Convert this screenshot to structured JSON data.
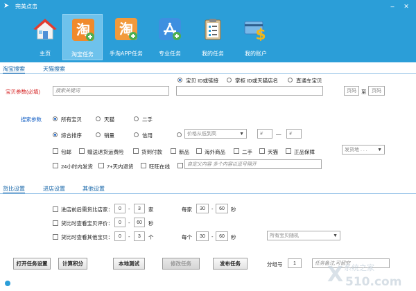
{
  "window": {
    "title": "完美点击"
  },
  "nav": [
    {
      "label": "主页",
      "icon": "home-icon",
      "active": false
    },
    {
      "label": "淘宝任务",
      "icon": "taobao-icon",
      "active": true
    },
    {
      "label": "手淘APP任务",
      "icon": "taobao-app-icon",
      "active": false
    },
    {
      "label": "专业任务",
      "icon": "appstore-icon",
      "active": false
    },
    {
      "label": "我的任务",
      "icon": "clipboard-icon",
      "active": false
    },
    {
      "label": "我的账户",
      "icon": "card-dollar-icon",
      "active": false
    }
  ],
  "search_tabs": [
    "淘宝搜索",
    "天猫搜索"
  ],
  "product_param": {
    "label": "宝贝参数(必填)",
    "keyword_placeholder": "搜索关键词",
    "radios": [
      "宝贝 ID或链接",
      "掌柜 ID或天猫店名",
      "直通车宝贝"
    ],
    "page_from_placeholder": "页码",
    "page_to_label": "至",
    "page_to_placeholder": "页码"
  },
  "search_params": {
    "label": "搜索参数",
    "type_radios": [
      "所有宝贝",
      "天猫",
      "二手"
    ],
    "sort_radios": [
      "综合排序",
      "销量",
      "信用"
    ],
    "price_sort_placeholder": "价格从低到高",
    "price_min_placeholder": "¥",
    "price_dash": "—",
    "price_max_placeholder": "¥",
    "checkboxes_row1": [
      "包邮",
      "赠送退货运费险",
      "货到付款",
      "新品",
      "海外商品",
      "二手",
      "天猫",
      "正品保障"
    ],
    "ship_from_placeholder": "发货地 . . .",
    "checkboxes_row2": [
      "24小时内发货",
      "7+天内退货",
      "旺旺在线"
    ],
    "custom_placeholder": "自定义内容    多个内容以逗号隔开"
  },
  "settings_tabs": [
    "货比设置",
    "进店设置",
    "其他设置"
  ],
  "compare": {
    "row1": {
      "label": "进店前后需货比店家：",
      "from": "0",
      "to": "3",
      "unit": "家",
      "each_label": "每家",
      "sec_from": "30",
      "sec_to": "60",
      "sec_unit": "秒"
    },
    "row2": {
      "label": "货比时查看宝贝评价：",
      "from": "0",
      "to": "60",
      "unit": "秒"
    },
    "row3": {
      "label": "货比时查看其他宝贝：",
      "from": "0",
      "to": "3",
      "unit": "个",
      "each_label": "每个",
      "sec_from": "30",
      "sec_to": "60",
      "sec_unit": "秒"
    },
    "random_select": "所有宝贝随机"
  },
  "actions": {
    "open_settings": "打开任务设置",
    "calc_points": "计算积分",
    "local_test": "本地测试",
    "edit_task": "修改任务",
    "publish_task": "发布任务",
    "group_label": "分组号",
    "group_value": "1",
    "remark_placeholder": "任务备注,可留空"
  },
  "watermark": {
    "text1": "系统之家",
    "text2": "510.com"
  },
  "colors": {
    "header": "#2b9ed8",
    "active_nav": "#6ec2ec",
    "link": "#1565a8",
    "required": "#d42020"
  }
}
